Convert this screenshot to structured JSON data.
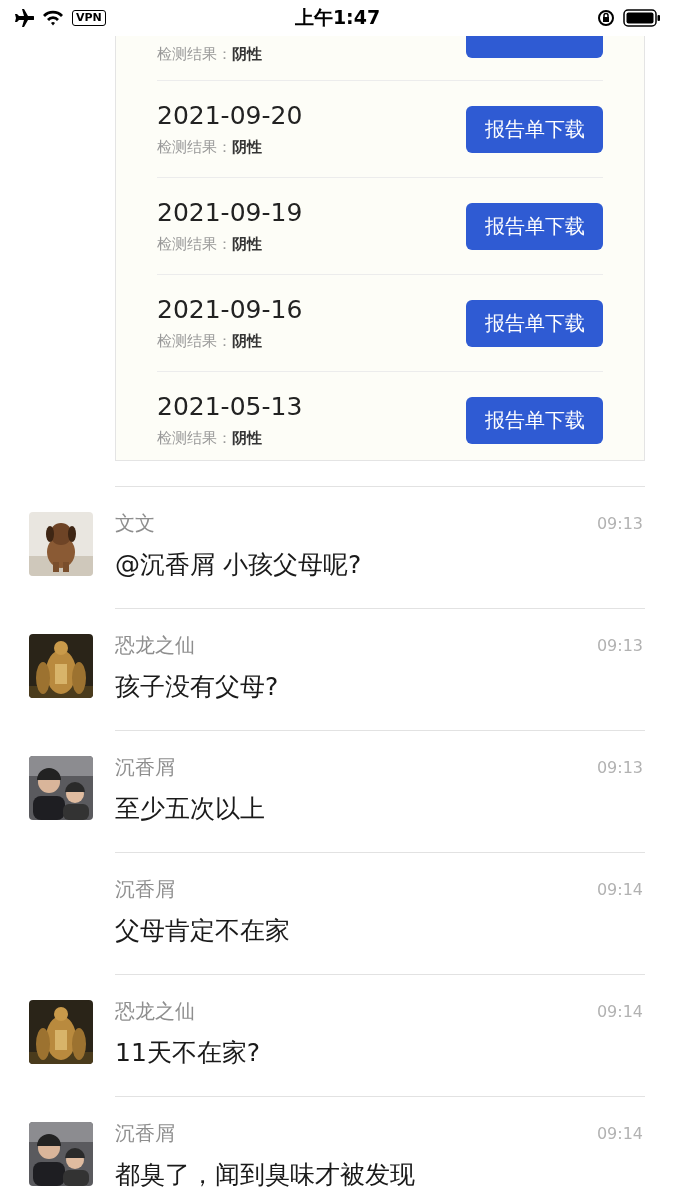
{
  "status_bar": {
    "vpn": "VPN",
    "time": "上午1:47"
  },
  "report_card": {
    "rows": [
      {
        "date": null,
        "result_label": "检测结果：",
        "result": "阴性",
        "button": null
      },
      {
        "date": "2021-09-20",
        "result_label": "检测结果：",
        "result": "阴性",
        "button": "报告单下载"
      },
      {
        "date": "2021-09-19",
        "result_label": "检测结果：",
        "result": "阴性",
        "button": "报告单下载"
      },
      {
        "date": "2021-09-16",
        "result_label": "检测结果：",
        "result": "阴性",
        "button": "报告单下载"
      },
      {
        "date": "2021-05-13",
        "result_label": "检测结果：",
        "result": "阴性",
        "button": "报告单下载"
      }
    ]
  },
  "messages": [
    {
      "sender": "文文",
      "time": "09:13",
      "text": "@沉香屑  小孩父母呢?",
      "avatar": true
    },
    {
      "sender": "恐龙之仙",
      "time": "09:13",
      "text": "孩子没有父母?",
      "avatar": true
    },
    {
      "sender": "沉香屑",
      "time": "09:13",
      "text": "至少五次以上",
      "avatar": true
    },
    {
      "sender": "沉香屑",
      "time": "09:14",
      "text": "父母肯定不在家",
      "avatar": false
    },
    {
      "sender": "恐龙之仙",
      "time": "09:14",
      "text": "11天不在家?",
      "avatar": true
    },
    {
      "sender": "沉香屑",
      "time": "09:14",
      "text": "都臭了，闻到臭味才被发现",
      "avatar": true
    }
  ]
}
